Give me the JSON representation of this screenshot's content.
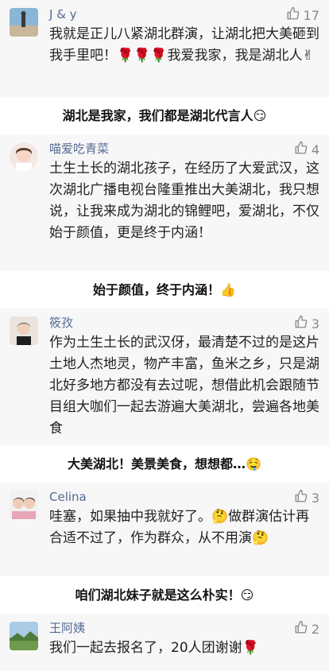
{
  "comments": [
    {
      "name": "J & y",
      "likes": "17",
      "text": "我就是正儿八紧湖北群演，让湖北把大美砸到我手里吧！🌹🌹🌹我爱我家，我是湖北人✌"
    },
    {
      "name": "喵爱吃青菜",
      "likes": "4",
      "text": "土生土长的湖北孩子，在经历了大爱武汉，这次湖北广播电视台隆重推出大美湖北，我只想说，让我来成为湖北的锦鲤吧，爱湖北，不仅始于颜值，更是终于内涵！"
    },
    {
      "name": "筱孜",
      "likes": "3",
      "text": "作为土生土长的武汉伢，最清楚不过的是这片土地人杰地灵，物产丰富，鱼米之乡，只是湖北好多地方都没有去过呢，想借此机会跟随节目组大咖们一起去游遍大美湖北，尝遍各地美食"
    },
    {
      "name": "Celina",
      "likes": "3",
      "text": "哇塞，如果抽中我就好了。🤔做群演估计再合适不过了，作为群众，从不用演🤔"
    },
    {
      "name": "王阿姨",
      "likes": "2",
      "text": "我们一起去报名了，20人团谢谢🌹"
    }
  ],
  "captions": [
    "湖北是我家，我们都是湖北代言人😏",
    "始于颜值，终于内涵！👍",
    "大美湖北！美景美食，想想都…🤤",
    "咱们湖北妹子就是这么朴实！😏"
  ],
  "colors": {
    "name": "#576b95",
    "comment_bg": "#f7f7f7",
    "text": "#222222"
  },
  "icons": {
    "like": "thumbs-up-icon"
  }
}
